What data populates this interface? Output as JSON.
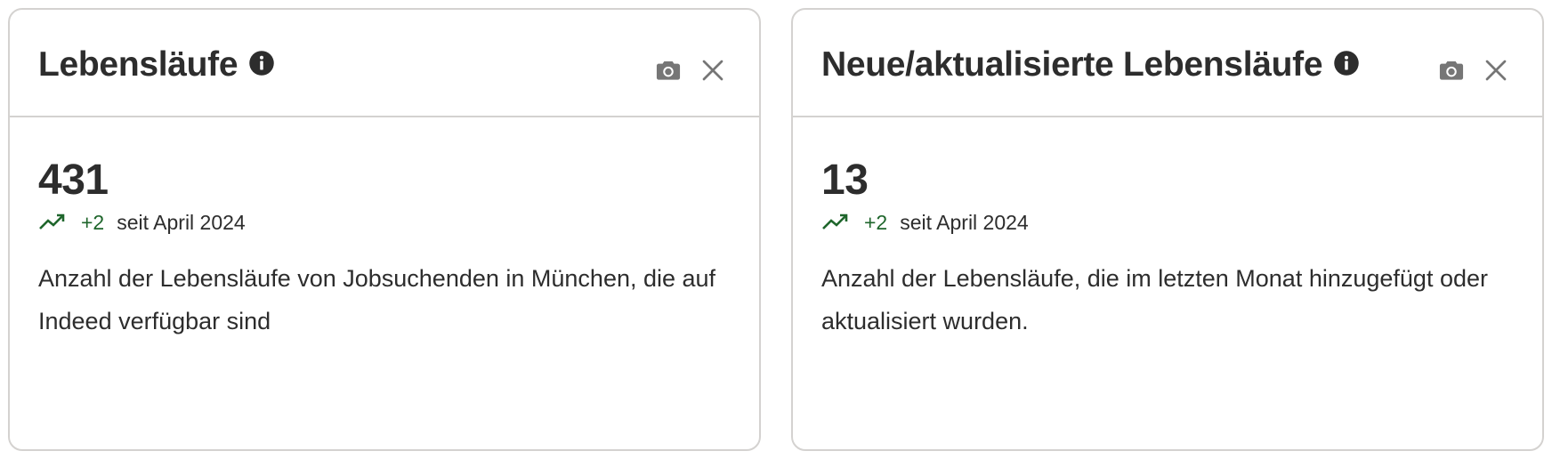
{
  "cards": [
    {
      "title": "Lebensläufe",
      "value": "431",
      "trend_delta": "+2",
      "trend_since": "seit April 2024",
      "description": "Anzahl der Lebensläufe von Jobsuchenden in München, die auf Indeed verfügbar sind"
    },
    {
      "title": "Neue/aktualisierte Lebensläufe",
      "value": "13",
      "trend_delta": "+2",
      "trend_since": "seit April 2024",
      "description": "Anzahl der Lebensläufe, die im letzten Monat hinzugefügt oder aktualisiert wurden."
    }
  ],
  "icons": {
    "info": "info-icon",
    "camera": "camera-icon",
    "close": "close-icon",
    "trend": "trending-up-icon"
  },
  "colors": {
    "text": "#2d2d2d",
    "border": "#d4d2d0",
    "icon_gray": "#767676",
    "trend_green": "#1f662c"
  }
}
